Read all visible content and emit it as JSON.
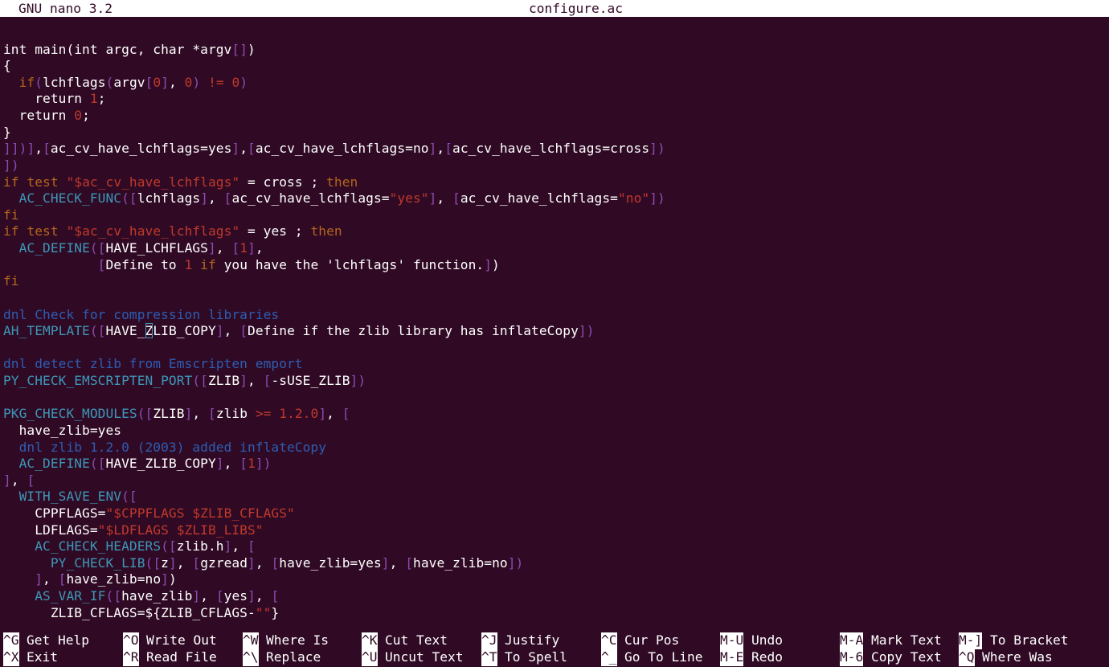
{
  "titlebar": {
    "version": "GNU nano 3.2",
    "filename": "configure.ac"
  },
  "colors": {
    "background": "#300a24",
    "foreground": "#ffffff",
    "function": "#3d97b8",
    "bracket": "#8b4bb2",
    "number_string": "#c0392b",
    "keyword": "#b5651d",
    "comment": "#2d5db3"
  },
  "editor": {
    "lines": [
      "",
      "int main(int argc, char *argv[])",
      "{",
      "  if(lchflags(argv[0], 0) != 0)",
      "    return 1;",
      "  return 0;",
      "}",
      "]])],[ac_cv_have_lchflags=yes],[ac_cv_have_lchflags=no],[ac_cv_have_lchflags=cross])",
      "])",
      "if test \"$ac_cv_have_lchflags\" = cross ; then",
      "  AC_CHECK_FUNC([lchflags], [ac_cv_have_lchflags=\"yes\"], [ac_cv_have_lchflags=\"no\"])",
      "fi",
      "if test \"$ac_cv_have_lchflags\" = yes ; then",
      "  AC_DEFINE([HAVE_LCHFLAGS], [1],",
      "            [Define to 1 if you have the 'lchflags' function.])",
      "fi",
      "",
      "dnl Check for compression libraries",
      "AH_TEMPLATE([HAVE_ZLIB_COPY], [Define if the zlib library has inflateCopy])",
      "",
      "dnl detect zlib from Emscripten emport",
      "PY_CHECK_EMSCRIPTEN_PORT([ZLIB], [-sUSE_ZLIB])",
      "",
      "PKG_CHECK_MODULES([ZLIB], [zlib >= 1.2.0], [",
      "  have_zlib=yes",
      "  dnl zlib 1.2.0 (2003) added inflateCopy",
      "  AC_DEFINE([HAVE_ZLIB_COPY], [1])",
      "], [",
      "  WITH_SAVE_ENV([",
      "    CPPFLAGS=\"$CPPFLAGS $ZLIB_CFLAGS\"",
      "    LDFLAGS=\"$LDFLAGS $ZLIB_LIBS\"",
      "    AC_CHECK_HEADERS([zlib.h], [",
      "      PY_CHECK_LIB([z], [gzread], [have_zlib=yes], [have_zlib=no])",
      "    ], [have_zlib=no])",
      "    AS_VAR_IF([have_zlib], [yes], [",
      "      ZLIB_CFLAGS=${ZLIB_CFLAGS-\"\"}"
    ]
  },
  "shortcuts": {
    "row1": [
      {
        "key": "^G",
        "label": "Get Help"
      },
      {
        "key": "^O",
        "label": "Write Out"
      },
      {
        "key": "^W",
        "label": "Where Is"
      },
      {
        "key": "^K",
        "label": "Cut Text"
      },
      {
        "key": "^J",
        "label": "Justify"
      },
      {
        "key": "^C",
        "label": "Cur Pos"
      },
      {
        "key": "M-U",
        "label": "Undo"
      },
      {
        "key": "M-A",
        "label": "Mark Text"
      },
      {
        "key": "M-]",
        "label": "To Bracket"
      }
    ],
    "row2": [
      {
        "key": "^X",
        "label": "Exit"
      },
      {
        "key": "^R",
        "label": "Read File"
      },
      {
        "key": "^\\",
        "label": "Replace"
      },
      {
        "key": "^U",
        "label": "Uncut Text"
      },
      {
        "key": "^T",
        "label": "To Spell"
      },
      {
        "key": "^_",
        "label": "Go To Line"
      },
      {
        "key": "M-E",
        "label": "Redo"
      },
      {
        "key": "M-6",
        "label": "Copy Text"
      },
      {
        "key": "^Q",
        "label": "Where Was"
      }
    ]
  }
}
